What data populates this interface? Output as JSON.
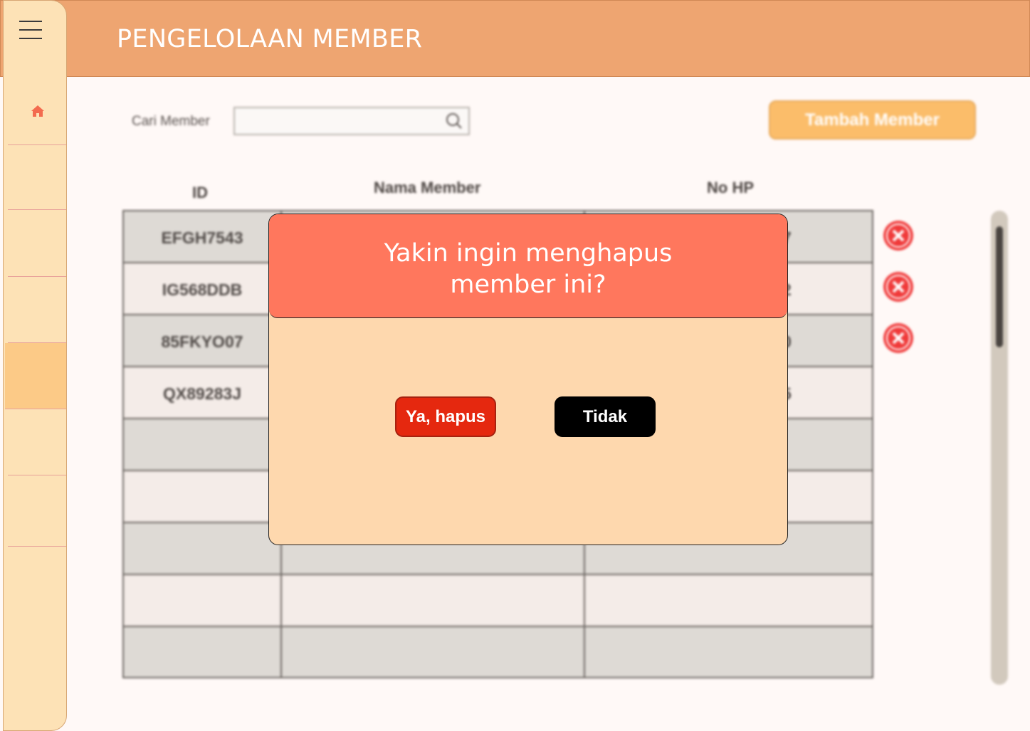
{
  "header": {
    "title": "PENGELOLAAN MEMBER"
  },
  "sidebar": {
    "menu_icon": "hamburger-menu-icon",
    "home_icon": "home-icon",
    "accent_color": "#fcca87"
  },
  "search": {
    "label": "Cari Member",
    "value": "",
    "placeholder": "",
    "icon": "search-icon"
  },
  "add_button": {
    "label": "Tambah Member"
  },
  "table": {
    "columns": [
      "ID",
      "Nama Member",
      "No HP"
    ],
    "rows": [
      {
        "id": "EFGH7543",
        "nama": "",
        "hp": "7"
      },
      {
        "id": "IG568DDB",
        "nama": "",
        "hp": "2"
      },
      {
        "id": "85FKYO07",
        "nama": "",
        "hp": "0"
      },
      {
        "id": "QX89283J",
        "nama": "",
        "hp": "5"
      },
      {
        "id": "",
        "nama": "",
        "hp": ""
      },
      {
        "id": "",
        "nama": "",
        "hp": ""
      },
      {
        "id": "",
        "nama": "",
        "hp": ""
      },
      {
        "id": "",
        "nama": "",
        "hp": ""
      },
      {
        "id": "",
        "nama": "",
        "hp": ""
      }
    ],
    "delete_icon": "delete-x-icon"
  },
  "modal": {
    "title": "Yakin ingin menghapus\nmember ini?",
    "confirm_label": "Ya, hapus",
    "cancel_label": "Tidak",
    "header_color": "#ff775d",
    "confirm_color": "#e5280f"
  }
}
